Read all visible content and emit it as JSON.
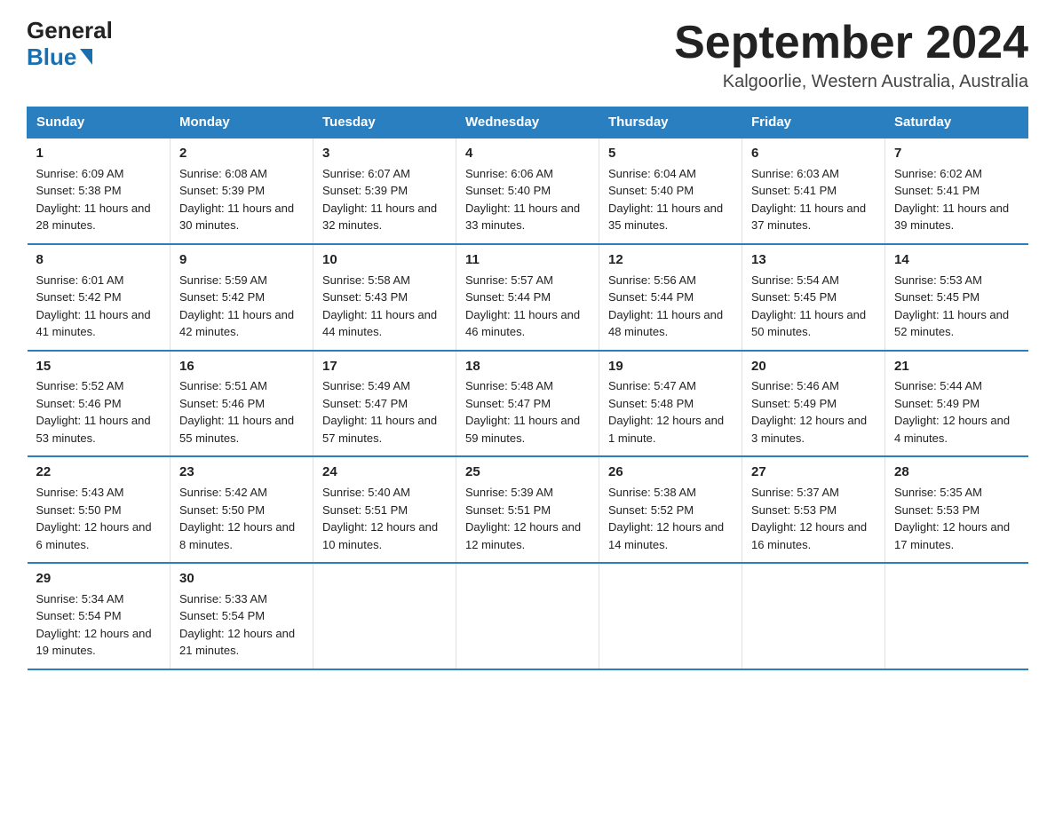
{
  "header": {
    "logo_general": "General",
    "logo_blue": "Blue",
    "month_title": "September 2024",
    "location": "Kalgoorlie, Western Australia, Australia"
  },
  "calendar": {
    "days_of_week": [
      "Sunday",
      "Monday",
      "Tuesday",
      "Wednesday",
      "Thursday",
      "Friday",
      "Saturday"
    ],
    "weeks": [
      [
        {
          "day": 1,
          "sunrise": "6:09 AM",
          "sunset": "5:38 PM",
          "daylight": "11 hours and 28 minutes."
        },
        {
          "day": 2,
          "sunrise": "6:08 AM",
          "sunset": "5:39 PM",
          "daylight": "11 hours and 30 minutes."
        },
        {
          "day": 3,
          "sunrise": "6:07 AM",
          "sunset": "5:39 PM",
          "daylight": "11 hours and 32 minutes."
        },
        {
          "day": 4,
          "sunrise": "6:06 AM",
          "sunset": "5:40 PM",
          "daylight": "11 hours and 33 minutes."
        },
        {
          "day": 5,
          "sunrise": "6:04 AM",
          "sunset": "5:40 PM",
          "daylight": "11 hours and 35 minutes."
        },
        {
          "day": 6,
          "sunrise": "6:03 AM",
          "sunset": "5:41 PM",
          "daylight": "11 hours and 37 minutes."
        },
        {
          "day": 7,
          "sunrise": "6:02 AM",
          "sunset": "5:41 PM",
          "daylight": "11 hours and 39 minutes."
        }
      ],
      [
        {
          "day": 8,
          "sunrise": "6:01 AM",
          "sunset": "5:42 PM",
          "daylight": "11 hours and 41 minutes."
        },
        {
          "day": 9,
          "sunrise": "5:59 AM",
          "sunset": "5:42 PM",
          "daylight": "11 hours and 42 minutes."
        },
        {
          "day": 10,
          "sunrise": "5:58 AM",
          "sunset": "5:43 PM",
          "daylight": "11 hours and 44 minutes."
        },
        {
          "day": 11,
          "sunrise": "5:57 AM",
          "sunset": "5:44 PM",
          "daylight": "11 hours and 46 minutes."
        },
        {
          "day": 12,
          "sunrise": "5:56 AM",
          "sunset": "5:44 PM",
          "daylight": "11 hours and 48 minutes."
        },
        {
          "day": 13,
          "sunrise": "5:54 AM",
          "sunset": "5:45 PM",
          "daylight": "11 hours and 50 minutes."
        },
        {
          "day": 14,
          "sunrise": "5:53 AM",
          "sunset": "5:45 PM",
          "daylight": "11 hours and 52 minutes."
        }
      ],
      [
        {
          "day": 15,
          "sunrise": "5:52 AM",
          "sunset": "5:46 PM",
          "daylight": "11 hours and 53 minutes."
        },
        {
          "day": 16,
          "sunrise": "5:51 AM",
          "sunset": "5:46 PM",
          "daylight": "11 hours and 55 minutes."
        },
        {
          "day": 17,
          "sunrise": "5:49 AM",
          "sunset": "5:47 PM",
          "daylight": "11 hours and 57 minutes."
        },
        {
          "day": 18,
          "sunrise": "5:48 AM",
          "sunset": "5:47 PM",
          "daylight": "11 hours and 59 minutes."
        },
        {
          "day": 19,
          "sunrise": "5:47 AM",
          "sunset": "5:48 PM",
          "daylight": "12 hours and 1 minute."
        },
        {
          "day": 20,
          "sunrise": "5:46 AM",
          "sunset": "5:49 PM",
          "daylight": "12 hours and 3 minutes."
        },
        {
          "day": 21,
          "sunrise": "5:44 AM",
          "sunset": "5:49 PM",
          "daylight": "12 hours and 4 minutes."
        }
      ],
      [
        {
          "day": 22,
          "sunrise": "5:43 AM",
          "sunset": "5:50 PM",
          "daylight": "12 hours and 6 minutes."
        },
        {
          "day": 23,
          "sunrise": "5:42 AM",
          "sunset": "5:50 PM",
          "daylight": "12 hours and 8 minutes."
        },
        {
          "day": 24,
          "sunrise": "5:40 AM",
          "sunset": "5:51 PM",
          "daylight": "12 hours and 10 minutes."
        },
        {
          "day": 25,
          "sunrise": "5:39 AM",
          "sunset": "5:51 PM",
          "daylight": "12 hours and 12 minutes."
        },
        {
          "day": 26,
          "sunrise": "5:38 AM",
          "sunset": "5:52 PM",
          "daylight": "12 hours and 14 minutes."
        },
        {
          "day": 27,
          "sunrise": "5:37 AM",
          "sunset": "5:53 PM",
          "daylight": "12 hours and 16 minutes."
        },
        {
          "day": 28,
          "sunrise": "5:35 AM",
          "sunset": "5:53 PM",
          "daylight": "12 hours and 17 minutes."
        }
      ],
      [
        {
          "day": 29,
          "sunrise": "5:34 AM",
          "sunset": "5:54 PM",
          "daylight": "12 hours and 19 minutes."
        },
        {
          "day": 30,
          "sunrise": "5:33 AM",
          "sunset": "5:54 PM",
          "daylight": "12 hours and 21 minutes."
        },
        null,
        null,
        null,
        null,
        null
      ]
    ],
    "labels": {
      "sunrise": "Sunrise:",
      "sunset": "Sunset:",
      "daylight": "Daylight:"
    }
  }
}
